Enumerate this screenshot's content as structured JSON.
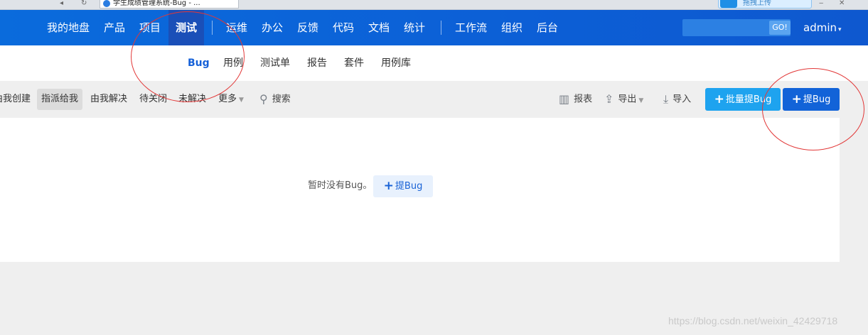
{
  "browser": {
    "tab_title": "学生成绩管理系统-Bug - ...",
    "upload_label": "拖拽上传",
    "minimize_glyph": "‒",
    "close_glyph": "✕"
  },
  "topnav": {
    "items": [
      {
        "label": "我的地盘"
      },
      {
        "label": "产品"
      },
      {
        "label": "项目"
      },
      {
        "label": "测试",
        "active": true
      },
      {
        "label": "运维"
      },
      {
        "label": "办公"
      },
      {
        "label": "反馈"
      },
      {
        "label": "代码"
      },
      {
        "label": "文档"
      },
      {
        "label": "统计"
      },
      {
        "label": "工作流"
      },
      {
        "label": "组织"
      },
      {
        "label": "后台"
      }
    ],
    "search_value": "",
    "go_label": "GO!",
    "user": "admin"
  },
  "subnav": {
    "items": [
      {
        "label": "Bug",
        "active": true
      },
      {
        "label": "用例"
      },
      {
        "label": "测试单"
      },
      {
        "label": "报告"
      },
      {
        "label": "套件"
      },
      {
        "label": "用例库"
      }
    ]
  },
  "toolbar": {
    "filters": [
      {
        "label": "由我创建"
      },
      {
        "label": "指派给我",
        "active": true
      },
      {
        "label": "由我解决"
      },
      {
        "label": "待关闭"
      },
      {
        "label": "未解决"
      },
      {
        "label": "更多"
      }
    ],
    "search_label": "搜索",
    "report_label": "报表",
    "export_label": "导出",
    "import_label": "导入",
    "batch_add_label": "批量提Bug",
    "add_label": "提Bug"
  },
  "content": {
    "empty_text": "暂时没有Bug。",
    "empty_button": "提Bug"
  },
  "watermark": "https://blog.csdn.net/weixin_42429718",
  "colors": {
    "nav_blue": "#0c5fd6",
    "primary": "#1263d8",
    "batch_primary": "#1ea3ef",
    "annotation_red": "#e23838"
  }
}
